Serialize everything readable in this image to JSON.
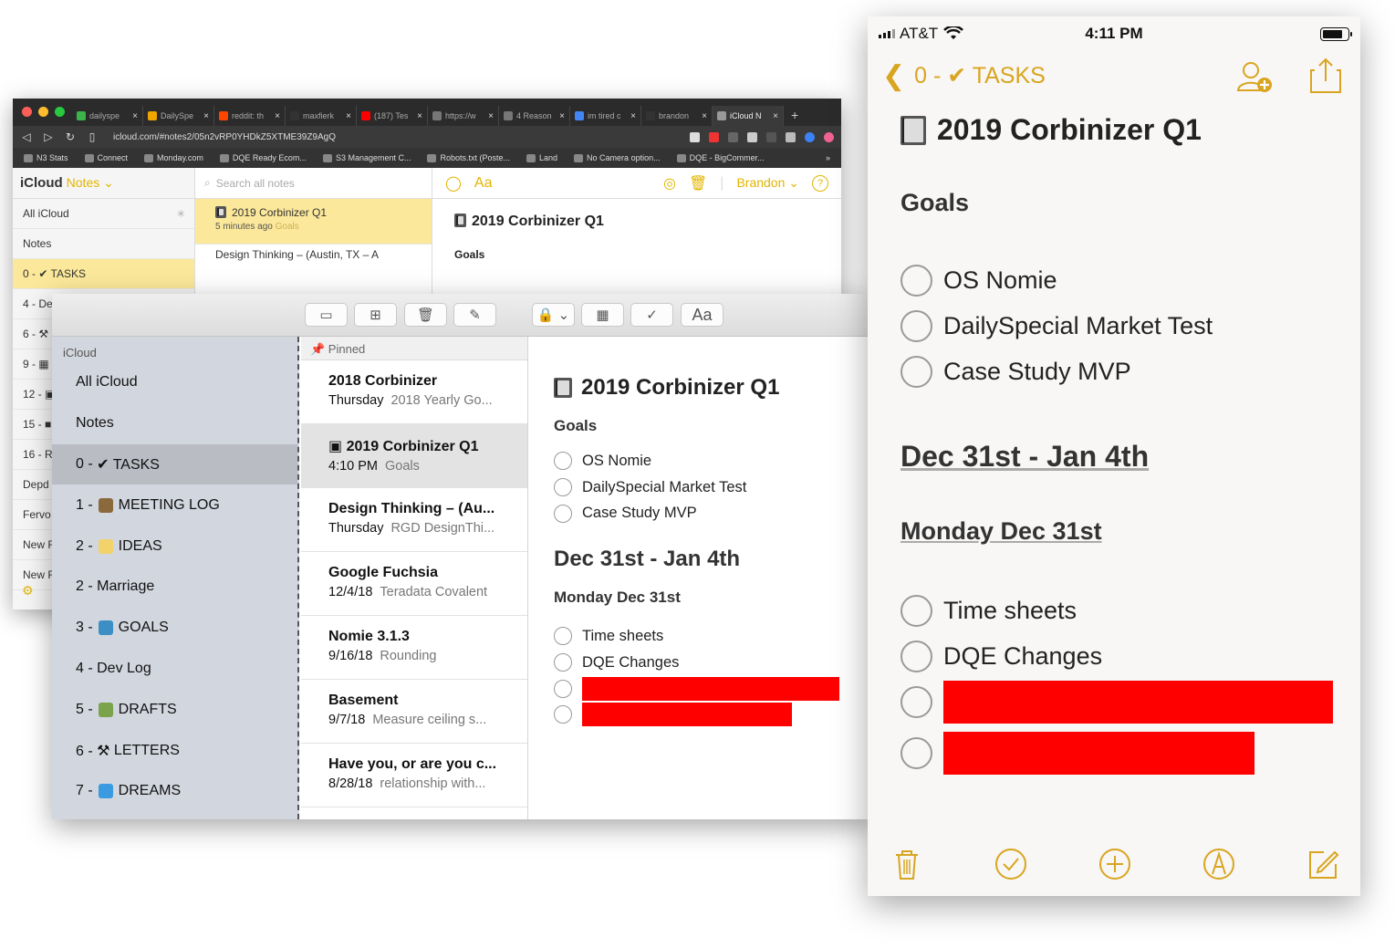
{
  "browser": {
    "tabs": [
      {
        "label": "dailyspe",
        "color": "#3bb54a"
      },
      {
        "label": "DailySpe",
        "color": "#f0a500"
      },
      {
        "label": "reddit: th",
        "color": "#ff4500"
      },
      {
        "label": "maxfierk",
        "color": "#333333"
      },
      {
        "label": "(187) Tes",
        "color": "#ff0000"
      },
      {
        "label": "https://w",
        "color": "#777777"
      },
      {
        "label": "4 Reason",
        "color": "#777777"
      },
      {
        "label": "im tired c",
        "color": "#4285f4"
      },
      {
        "label": "brandon",
        "color": "#333333"
      },
      {
        "label": "iCloud N",
        "color": "#999999"
      }
    ],
    "new_tab": "+",
    "url": "icloud.com/#notes2/05n2vRP0YHDkZ5XTME39Z9AgQ",
    "bookmarks": [
      "N3 Stats",
      "Connect",
      "Monday.com",
      "DQE Ready Ecom...",
      "S3 Management C...",
      "Robots.txt (Poste...",
      "Land",
      "No Camera option...",
      "DQE - BigCommer..."
    ],
    "more": "»"
  },
  "icloud": {
    "brand": "iCloud",
    "app": "Notes ⌄",
    "folders": [
      "All iCloud",
      "Notes",
      "0 - ✔ TASKS",
      "4 - De",
      "6 - ⚒",
      "9 - ▦",
      "12 - ▣",
      "15 - ■",
      "16 - R",
      "Depd",
      "Fervo",
      "New F",
      "New F"
    ],
    "search_placeholder": "Search all notes",
    "note": {
      "title": "2019 Corbinizer Q1",
      "time": "5 minutes ago",
      "preview": "Goals"
    },
    "note2": "Design Thinking – (Austin, TX – A",
    "aa": "Aa",
    "user": "Brandon ⌄",
    "help": "?",
    "doc_title": "2019 Corbinizer Q1",
    "doc_h2": "Goals"
  },
  "mac": {
    "toolbar": {
      "sidebar": "▭",
      "grid": "⊞",
      "trash": "🗑",
      "compose": "✎",
      "lock": "🔒 ⌄",
      "table": "▦",
      "check": "✓",
      "aa": "Aa"
    },
    "sidebar_header": "iCloud",
    "folders": [
      {
        "prefix": "All iCloud",
        "label": "",
        "color": ""
      },
      {
        "prefix": "Notes",
        "label": "",
        "color": ""
      },
      {
        "prefix": "0 -",
        "label": "✔  TASKS",
        "color": ""
      },
      {
        "prefix": "1 -",
        "label": "MEETING LOG",
        "color": "#8a6a3c"
      },
      {
        "prefix": "2 -",
        "label": "IDEAS",
        "color": "#f2d36b"
      },
      {
        "prefix": "2 - Marriage",
        "label": "",
        "color": ""
      },
      {
        "prefix": "3 -",
        "label": "GOALS",
        "color": "#3c8fc4"
      },
      {
        "prefix": "4 - Dev Log",
        "label": "",
        "color": ""
      },
      {
        "prefix": "5 -",
        "label": "DRAFTS",
        "color": "#7aa34c"
      },
      {
        "prefix": "6 - ⚒",
        "label": "LETTERS",
        "color": ""
      },
      {
        "prefix": "7 -",
        "label": "DREAMS",
        "color": "#3a9be0"
      }
    ],
    "pinned": "📌 Pinned",
    "notes": [
      {
        "title": "2018 Corbinizer",
        "date": "Thursday",
        "preview": "2018 Yearly Go..."
      },
      {
        "title": "▣ 2019 Corbinizer Q1",
        "date": "4:10 PM",
        "preview": "Goals"
      },
      {
        "title": "Design Thinking – (Au...",
        "date": "Thursday",
        "preview": "RGD DesignThi..."
      },
      {
        "title": "Google Fuchsia",
        "date": "12/4/18",
        "preview": "Teradata Covalent"
      },
      {
        "title": "Nomie 3.1.3",
        "date": "9/16/18",
        "preview": "Rounding"
      },
      {
        "title": "Basement",
        "date": "9/7/18",
        "preview": "Measure ceiling s..."
      },
      {
        "title": "Have you, or are you c...",
        "date": "8/28/18",
        "preview": "relationship with..."
      }
    ],
    "editor": {
      "title": "2019 Corbinizer Q1",
      "goals": "Goals",
      "goal_items": [
        "OS Nomie",
        "DailySpecial Market Test",
        "Case Study MVP"
      ],
      "week": "Dec 31st - Jan 4th",
      "day": "Monday Dec 31st",
      "day_items": [
        "Time sheets",
        "DQE Changes"
      ]
    }
  },
  "phone": {
    "carrier": "AT&T",
    "time": "4:11 PM",
    "back_label": "0 - ✔ TASKS",
    "title": "2019 Corbinizer Q1",
    "goals": "Goals",
    "goal_items": [
      "OS Nomie",
      "DailySpecial Market Test",
      "Case Study MVP"
    ],
    "week": "Dec 31st - Jan 4th",
    "day": "Monday Dec 31st",
    "day_items": [
      "Time sheets",
      "DQE Changes"
    ]
  },
  "colors": {
    "accent": "#d9a520",
    "redaction": "#ff0000",
    "selection_yellow": "#fbe89a"
  }
}
